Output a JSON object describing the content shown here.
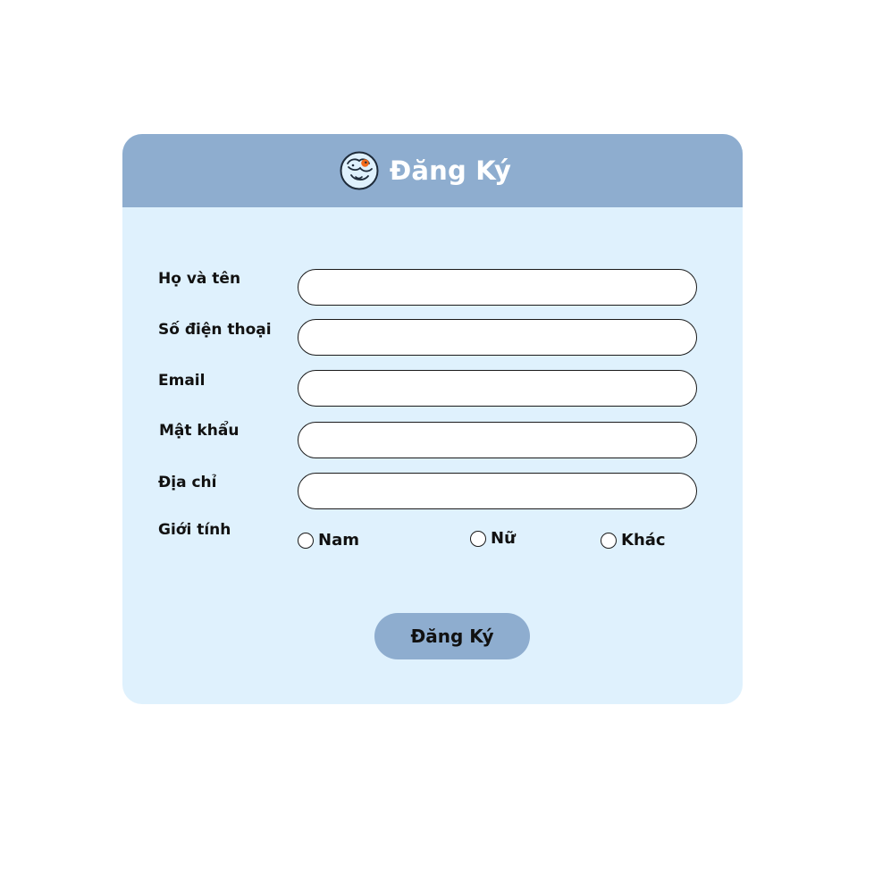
{
  "header": {
    "title": "Đăng Ký",
    "logo_icon": "dog-logo-icon"
  },
  "form": {
    "fields": [
      {
        "label": "Họ và tên",
        "value": "",
        "placeholder": ""
      },
      {
        "label": "Số điện thoại",
        "value": "",
        "placeholder": ""
      },
      {
        "label": "Email",
        "value": "",
        "placeholder": ""
      },
      {
        "label": "Mật khẩu",
        "value": "",
        "placeholder": ""
      },
      {
        "label": "Địa chỉ",
        "value": "",
        "placeholder": ""
      }
    ],
    "gender": {
      "label": "Giới tính",
      "options": [
        "Nam",
        "Nữ",
        "Khác"
      ]
    },
    "submit_label": "Đăng Ký"
  },
  "colors": {
    "header_bg": "#8eadcf",
    "card_bg": "#dff1fd",
    "button_bg": "#8eadcf",
    "logo_accent": "#f26a1b"
  }
}
